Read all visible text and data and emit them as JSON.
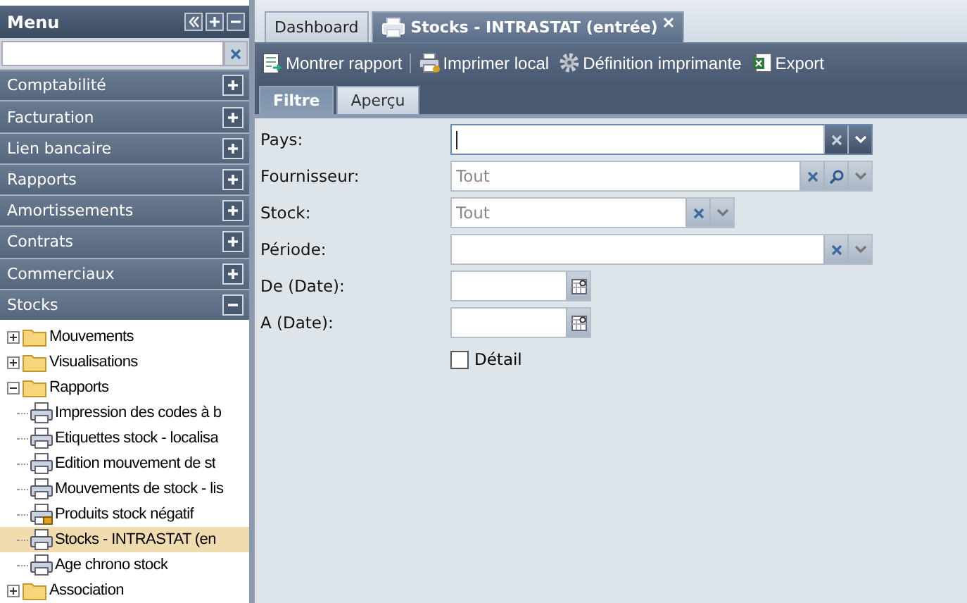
{
  "menu": {
    "title": "Menu",
    "sections": [
      {
        "label": "Comptabilité",
        "expanded": false
      },
      {
        "label": "Facturation",
        "expanded": false
      },
      {
        "label": "Lien bancaire",
        "expanded": false
      },
      {
        "label": "Rapports",
        "expanded": false
      },
      {
        "label": "Amortissements",
        "expanded": false
      },
      {
        "label": "Contrats",
        "expanded": false
      },
      {
        "label": "Commerciaux",
        "expanded": false
      },
      {
        "label": "Stocks",
        "expanded": true
      }
    ],
    "tree": [
      {
        "label": "Mouvements",
        "kind": "folder",
        "expanded": false
      },
      {
        "label": "Visualisations",
        "kind": "folder",
        "expanded": false
      },
      {
        "label": "Rapports",
        "kind": "folder",
        "expanded": true,
        "children": [
          {
            "label": "Impression des codes à b",
            "kind": "report",
            "selected": false
          },
          {
            "label": "Etiquettes stock - localisa",
            "kind": "report",
            "selected": false
          },
          {
            "label": "Edition mouvement de st",
            "kind": "report",
            "selected": false
          },
          {
            "label": "Mouvements de stock - lis",
            "kind": "report",
            "selected": false
          },
          {
            "label": "Produits stock négatif",
            "kind": "report-locked",
            "selected": false
          },
          {
            "label": "Stocks - INTRASTAT (en",
            "kind": "report",
            "selected": true
          },
          {
            "label": "Age chrono stock",
            "kind": "report",
            "selected": false
          }
        ]
      },
      {
        "label": "Association",
        "kind": "folder",
        "expanded": false
      }
    ]
  },
  "tabs": [
    {
      "label": "Dashboard",
      "selected": false,
      "closable": false
    },
    {
      "label": "Stocks - INTRASTAT (entrée)",
      "selected": true,
      "closable": true
    }
  ],
  "toolbar": [
    {
      "label": "Montrer rapport",
      "kind": "report"
    },
    {
      "label": "Imprimer local",
      "kind": "print"
    },
    {
      "label": "Définition imprimante",
      "kind": "gear"
    },
    {
      "label": "Export",
      "kind": "excel"
    }
  ],
  "subtabs": [
    {
      "label": "Filtre",
      "selected": true
    },
    {
      "label": "Aperçu",
      "selected": false
    }
  ],
  "fields": [
    {
      "label": "Pays:",
      "kind": "combo",
      "focused": true,
      "search": false
    },
    {
      "label": "Fournisseur:",
      "kind": "combo",
      "placeholder": "Tout",
      "focused": false,
      "search": true
    },
    {
      "label": "Stock:",
      "kind": "short-combo",
      "placeholder": "Tout",
      "focused": false,
      "search": false
    },
    {
      "label": "Période:",
      "kind": "combo",
      "focused": false,
      "search": false
    },
    {
      "label": "De (Date):",
      "kind": "date"
    },
    {
      "label": "A (Date):",
      "kind": "date"
    },
    {
      "label": "Détail",
      "kind": "checkbox",
      "checked": false
    }
  ]
}
